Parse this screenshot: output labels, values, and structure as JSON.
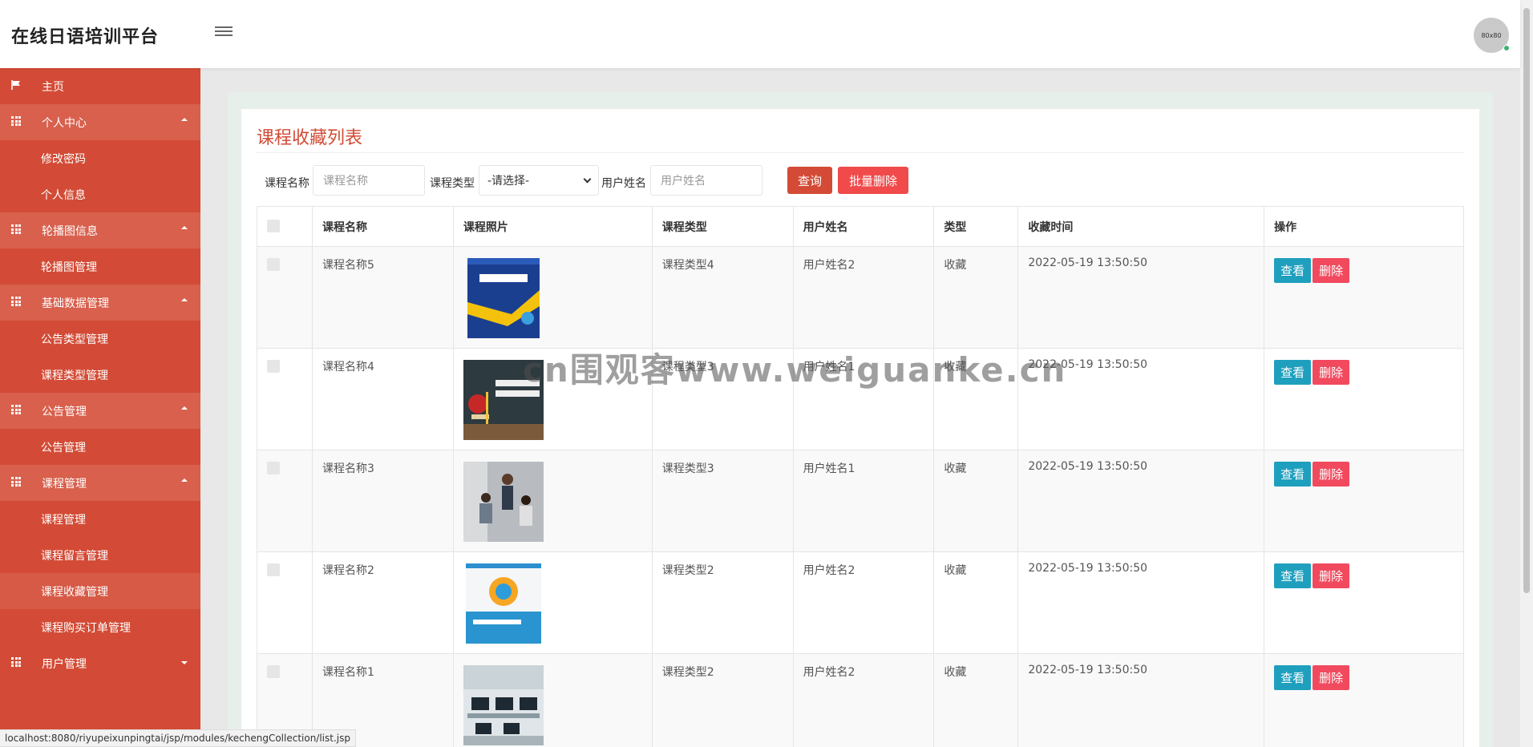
{
  "header": {
    "title": "在线日语培训平台",
    "avatar_text": "80x80"
  },
  "sidebar": {
    "home": "主页",
    "groups": [
      {
        "label": "个人中心",
        "items": [
          "修改密码",
          "个人信息"
        ]
      },
      {
        "label": "轮播图信息",
        "items": [
          "轮播图管理"
        ]
      },
      {
        "label": "基础数据管理",
        "items": [
          "公告类型管理",
          "课程类型管理"
        ]
      },
      {
        "label": "公告管理",
        "items": [
          "公告管理"
        ]
      },
      {
        "label": "课程管理",
        "items": [
          "课程管理",
          "课程留言管理",
          "课程收藏管理",
          "课程购买订单管理"
        ]
      },
      {
        "label": "用户管理",
        "items": []
      }
    ]
  },
  "page": {
    "title": "课程收藏列表"
  },
  "filters": {
    "course_name_label": "课程名称",
    "course_name_placeholder": "课程名称",
    "course_type_label": "课程类型",
    "course_type_value": "-请选择-",
    "user_name_label": "用户姓名",
    "user_name_placeholder": "用户姓名",
    "query_button": "查询",
    "bulk_delete_button": "批量删除"
  },
  "table": {
    "headers": [
      "课程名称",
      "课程照片",
      "课程类型",
      "用户姓名",
      "类型",
      "收藏时间",
      "操作"
    ],
    "view_label": "查看",
    "delete_label": "删除",
    "rows": [
      {
        "course_name": "课程名称5",
        "course_type": "课程类型4",
        "user_name": "用户姓名2",
        "type": "收藏",
        "time": "2022-05-19 13:50:50",
        "photo": "book-cover-computer"
      },
      {
        "course_name": "课程名称4",
        "course_type": "课程类型3",
        "user_name": "用户姓名1",
        "type": "收藏",
        "time": "2022-05-19 13:50:50",
        "photo": "reading-writing-chalkboard"
      },
      {
        "course_name": "课程名称3",
        "course_type": "课程类型3",
        "user_name": "用户姓名1",
        "type": "收藏",
        "time": "2022-05-19 13:50:50",
        "photo": "classroom-students"
      },
      {
        "course_name": "课程名称2",
        "course_type": "课程类型2",
        "user_name": "用户姓名2",
        "type": "收藏",
        "time": "2022-05-19 13:50:50",
        "photo": "book-cover-java"
      },
      {
        "course_name": "课程名称1",
        "course_type": "课程类型2",
        "user_name": "用户姓名2",
        "type": "收藏",
        "time": "2022-05-19 13:50:50",
        "photo": "computer-lab"
      }
    ]
  },
  "statusbar": {
    "url": "localhost:8080/riyupeixunpingtai/jsp/modules/kechengCollection/list.jsp"
  },
  "watermark": "cn围观客www.weiguanke.cn",
  "colors": {
    "primary": "#d34b36",
    "view_button": "#1f9fbe",
    "delete_button": "#f14a5e"
  }
}
